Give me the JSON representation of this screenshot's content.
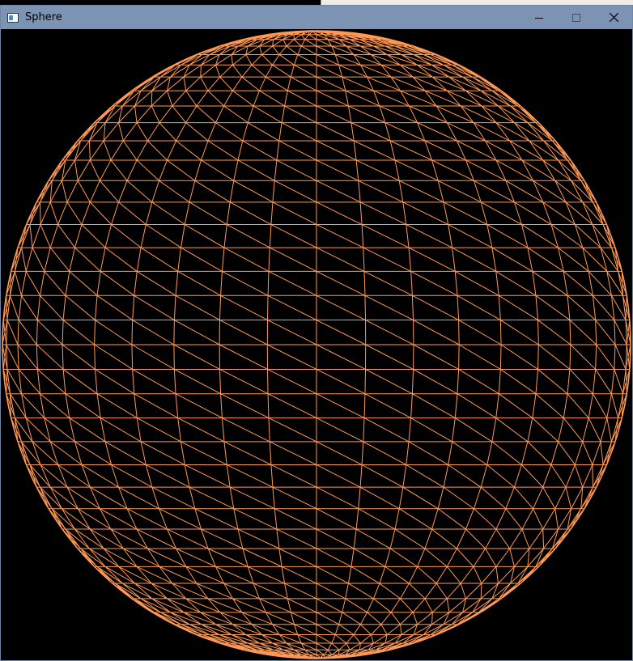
{
  "window": {
    "title": "Sphere",
    "controls": {
      "minimize_icon": "minimize-icon",
      "maximize_icon": "maximize-icon",
      "close_icon": "close-icon"
    }
  },
  "colors": {
    "titlebar": "#7c93b4",
    "background": "#000000",
    "wireframe": "#ff9955"
  },
  "canvas": {
    "content": "wireframe-sphere",
    "latitude_rings": 40,
    "longitude_segments": 40,
    "triangulated": true
  }
}
